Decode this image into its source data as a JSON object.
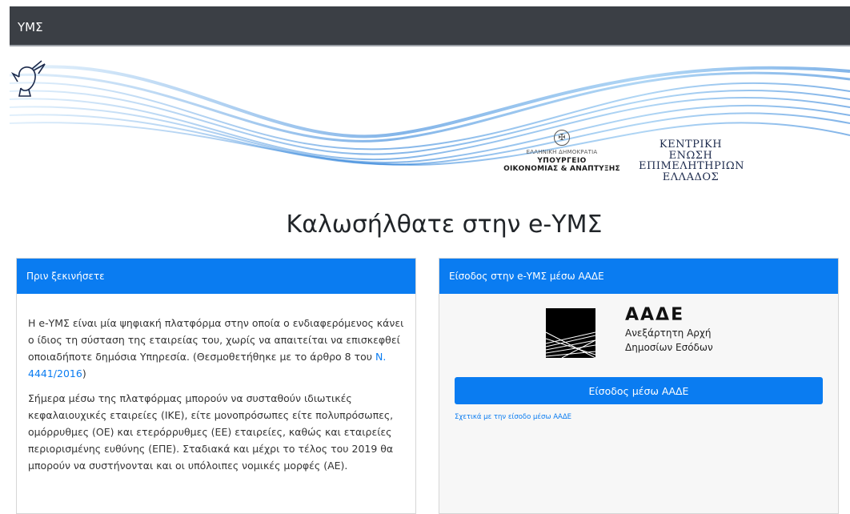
{
  "navbar": {
    "brand": "ΥΜΣ"
  },
  "banner": {
    "ministry": {
      "line1": "ΕΛΛΗΝΙΚΗ ΔΗΜΟΚΡΑΤΙΑ",
      "line2": "ΥΠΟΥΡΓΕΙΟ",
      "line3": "ΟΙΚΟΝΟΜΙΑΣ & ΑΝΑΠΤΥΞΗΣ"
    },
    "chamber": {
      "line1": "ΚΕΝΤΡΙΚΗ ΕΝΩΣΗ",
      "line2": "ΕΠΙΜΕΛΗΤΗΡΙΩΝ",
      "line3": "ΕΛΛΑΔΟΣ"
    },
    "wave_colors": [
      "#1e78d6",
      "#6fb4ec",
      "#c9e3f8"
    ]
  },
  "page_title": "Καλωσήλθατε στην e-ΥΜΣ",
  "left_panel": {
    "header": "Πριν ξεκινήσετε",
    "para1_text": "Η e-ΥΜΣ είναι μία ψηφιακή πλατφόρμα στην οποία ο ενδιαφερόμενος κάνει ο ίδιος τη σύσταση της εταιρείας του, χωρίς να απαιτείται να επισκεφθεί οποιαδήποτε δημόσια Υπηρεσία. (Θεσμοθετήθηκε με το άρθρο 8 του ",
    "law_link": "Ν. 4441/2016",
    "para1_end": ")",
    "para2": "Σήμερα μέσω της πλατφόρμας μπορούν να συσταθούν ιδιωτικές κεφαλαιουχικές εταιρείες (ΙΚΕ), είτε μονοπρόσωπες είτε πολυπρόσωπες, ομόρρυθμες (ΟΕ) και ετερόρρυθμες (ΕΕ) εταιρείες, καθώς και εταιρείες περιορισμένης ευθύνης (ΕΠΕ). Σταδιακά και μέχρι το τέλος του 2019 θα μπορούν να συστήνονται και οι υπόλοιπες νομικές μορφές (ΑΕ)."
  },
  "right_panel": {
    "header": "Είσοδος στην e-ΥΜΣ μέσω ΑΑΔΕ",
    "aade_name": "ΑΑΔΕ",
    "aade_sub1": "Ανεξάρτητη Αρχή",
    "aade_sub2": "Δημοσίων Εσόδων",
    "login_button": "Είσοδος μέσω ΑΑΔΕ",
    "about_link": "Σχετικά με την είσοδο μέσω ΑΑΔΕ"
  },
  "colors": {
    "primary": "#0a7cf1",
    "navbar": "#3b3f45"
  }
}
